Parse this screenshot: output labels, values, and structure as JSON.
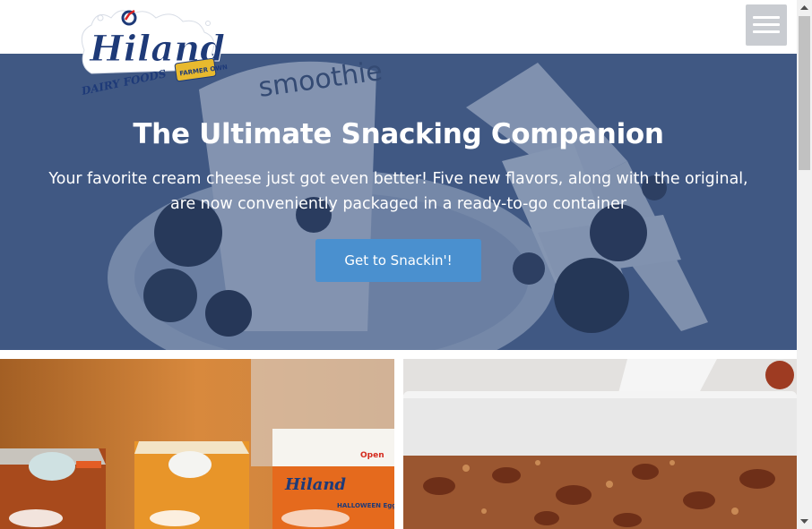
{
  "header": {
    "logo": {
      "brand": "Hiland",
      "tagline": "DAIRY FOODS",
      "badge": "FARMER OWNED"
    },
    "menu_icon": "hamburger-menu-icon"
  },
  "hero": {
    "title": "The Ultimate Snacking Companion",
    "subtitle": "Your favorite cream cheese just got even better! Five new flavors, along with the original, are now conveniently packaged in a ready-to-go container",
    "cta_label": "Get to Snackin'!",
    "background_text": "smoothie",
    "overlay_color": "#304a7a",
    "cta_color": "#4a90cf"
  },
  "cards": [
    {
      "image": "hiland-milk-cartons-photo",
      "carton_labels": [
        "Hiland",
        "HALLOWEEN Egg Nog",
        "Open"
      ]
    },
    {
      "image": "pecan-dessert-bars-photo"
    }
  ],
  "scrollbar": {
    "up_icon": "scroll-up-arrow-icon",
    "down_icon": "scroll-down-arrow-icon"
  }
}
